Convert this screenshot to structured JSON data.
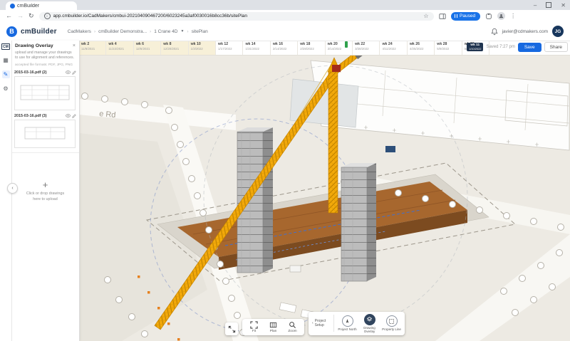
{
  "browser": {
    "tab_title": "cmBuilder",
    "url": "app.cmbuilder.io/CadMakers/cmbui-202104090467200/6023245a3af0030016b8cc36b/sitePlan",
    "paused_label": "Paused"
  },
  "header": {
    "logo_text": "cmBuilder",
    "breadcrumbs": [
      "CadMakers",
      "cmBuilder Demonstra...",
      "1 Crane 4D",
      "sitePlan"
    ],
    "user_email": "javier@cdmakers.com",
    "avatar_initials": "JG"
  },
  "sidebar": {
    "cm_label": "CM"
  },
  "timeline": {
    "warm_count": 5,
    "weeks": [
      {
        "label": "wk 2",
        "date": "11/8/2021"
      },
      {
        "label": "wk 4",
        "date": "11/22/2021"
      },
      {
        "label": "wk 6",
        "date": "12/6/2021"
      },
      {
        "label": "wk 8",
        "date": "12/20/2021"
      },
      {
        "label": "wk 10",
        "date": "1/3/2022"
      },
      {
        "label": "wk 12",
        "date": "1/17/2022"
      },
      {
        "label": "wk 14",
        "date": "1/31/2022"
      },
      {
        "label": "wk 16",
        "date": "2/14/2022"
      },
      {
        "label": "wk 18",
        "date": "2/28/2022"
      },
      {
        "label": "wk 20",
        "date": "3/14/2022"
      },
      {
        "label": "wk 22",
        "date": "3/28/2022"
      },
      {
        "label": "wk 24",
        "date": "4/11/2022"
      },
      {
        "label": "wk 26",
        "date": "4/25/2022"
      },
      {
        "label": "wk 28",
        "date": "5/9/2022"
      },
      {
        "label": "wk 30",
        "date": "5/23/2022"
      }
    ],
    "current": {
      "week_label": "wk 11",
      "date": "1/10/2022"
    },
    "saved_text": "Saved 7:27 pm",
    "save_label": "Save",
    "share_label": "Share"
  },
  "panel": {
    "title": "Drawing Overlay",
    "description": "upload and manage your drawings to use for alignment and references.",
    "formats": "accepted file formats: PDF, JPG, PNG",
    "files": [
      {
        "name": "2015-03-16.pdf (2)"
      },
      {
        "name": "2015-03-16.pdf (3)"
      }
    ],
    "upload_text": "Click or drop drawings here to upload"
  },
  "canvas": {
    "road_label": "e Rd"
  },
  "toolbar": {
    "fit_label": "Fit",
    "plan_label": "Plan",
    "zoom_label": "Zoom",
    "project_setup_label": "Project Setup",
    "north_label": "Project North",
    "overlay_label": "Drawing Overlay",
    "property_label": "Property Line"
  },
  "colors": {
    "accent_blue": "#1769e0",
    "crane_yellow": "#f3a90a",
    "deck_brown": "#a7672e",
    "marker_green": "#2fa14c",
    "active_circle": "#31455e"
  }
}
